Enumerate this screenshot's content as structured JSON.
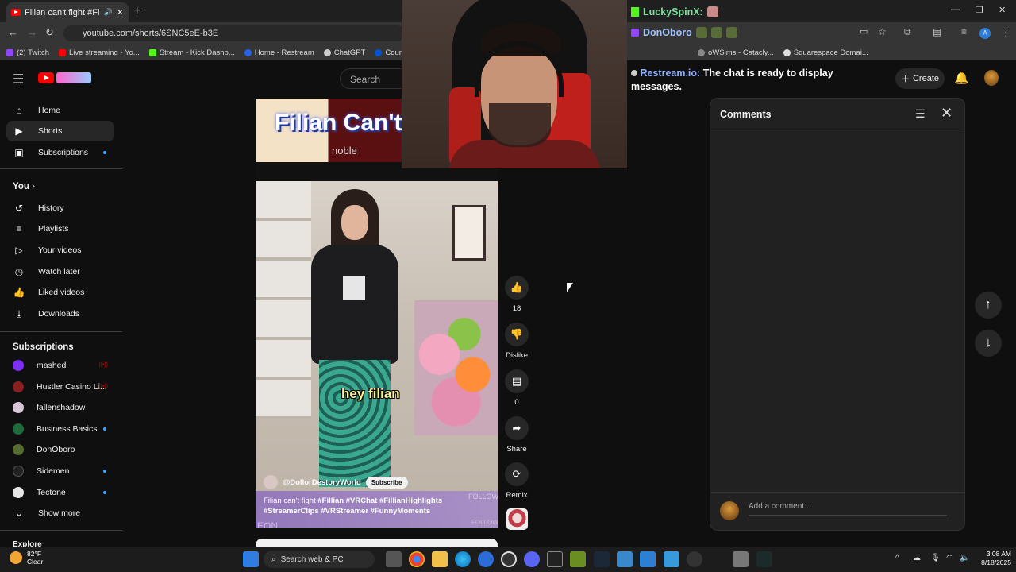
{
  "browser": {
    "tab_title": "Filian can't fight #Fillian #V",
    "new_tab": "+",
    "url": "youtube.com/shorts/6SNC5eE-b3E",
    "bookmarks": [
      "(2) Twitch",
      "Live streaming - Yo...",
      "Stream - Kick Dashb...",
      "Home - Restream",
      "ChatGPT",
      "Coursera | Online C...",
      "oWSims - Catacly...",
      "Squarespace Domai..."
    ]
  },
  "header": {
    "search_placeholder": "Search",
    "create_label": "Create"
  },
  "sidebar": {
    "main": [
      {
        "label": "Home",
        "icon": "home-icon"
      },
      {
        "label": "Shorts",
        "icon": "shorts-icon"
      },
      {
        "label": "Subscriptions",
        "icon": "subscriptions-icon"
      }
    ],
    "you_title": "You",
    "you": [
      {
        "label": "History",
        "icon": "history-icon"
      },
      {
        "label": "Playlists",
        "icon": "playlists-icon"
      },
      {
        "label": "Your videos",
        "icon": "your-videos-icon"
      },
      {
        "label": "Watch later",
        "icon": "watch-later-icon"
      },
      {
        "label": "Liked videos",
        "icon": "liked-videos-icon"
      },
      {
        "label": "Downloads",
        "icon": "downloads-icon"
      }
    ],
    "subs_title": "Subscriptions",
    "subs": [
      {
        "label": "mashed",
        "color": "#7b2ff7"
      },
      {
        "label": "Hustler Casino Li...",
        "color": "#8a1f1f"
      },
      {
        "label": "fallenshadow",
        "color": "#d8c7d8"
      },
      {
        "label": "Business Basics",
        "color": "#1e6b3a"
      },
      {
        "label": "DonOboro",
        "color": "#556b2f"
      },
      {
        "label": "Sidemen",
        "color": "#222222"
      },
      {
        "label": "Tectone",
        "color": "#e6e6e6"
      }
    ],
    "show_more": "Show more",
    "explore": "Explore"
  },
  "short": {
    "banner_text": "Filian Can't",
    "banner_logo": "noble",
    "caption": "hey filian",
    "channel": "@DollorDestoryWorld",
    "subscribe": "Subscribe",
    "title_plain": "Filian can't fight",
    "title_tags": "#Fillian #VRChat #FillianHighlights #StreamerClips #VRStreamer #FunnyMoments",
    "follow": "FOLLOW",
    "eon": "EON"
  },
  "actions": {
    "likes": "18",
    "dislike": "Dislike",
    "comments": "0",
    "share": "Share",
    "remix": "Remix"
  },
  "chat": {
    "user1": "LuckySpinX:",
    "user2": "DonOboro",
    "restream_user": "Restream.io:",
    "restream_msg": "The chat is ready to display messages."
  },
  "comments": {
    "title": "Comments",
    "add_placeholder": "Add a comment..."
  },
  "taskbar": {
    "temp": "82°F",
    "weather": "Clear",
    "search": "Search web & PC",
    "time": "3:08 AM",
    "date": "8/18/2025"
  }
}
